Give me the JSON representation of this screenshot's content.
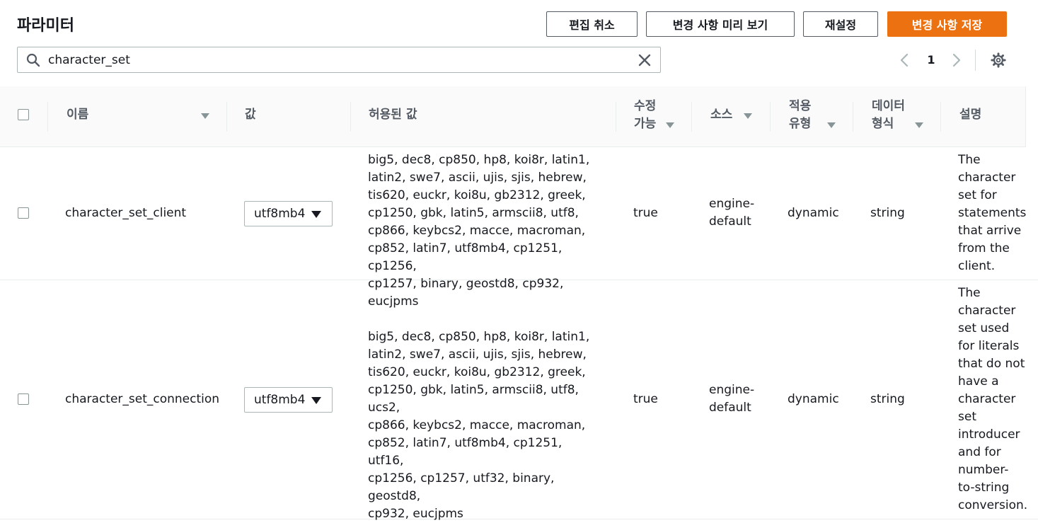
{
  "header": {
    "title": "파라미터",
    "buttons": {
      "cancel_edit": "편집 취소",
      "preview": "변경 사항 미리 보기",
      "reset": "재설정",
      "save": "변경 사항 저장"
    }
  },
  "search": {
    "value": "character_set"
  },
  "pagination": {
    "page": "1"
  },
  "colors": {
    "primary": "#ec7211",
    "border": "#aab7b8",
    "header_text": "#545b64"
  },
  "table": {
    "columns": {
      "name": "이름",
      "value": "값",
      "allowed": "허용된 값",
      "modifiable": [
        "수정",
        "가능"
      ],
      "source": "소스",
      "apply_type": [
        "적용",
        "유형"
      ],
      "data_type": [
        "데이터",
        "형식"
      ],
      "description": "설명"
    },
    "rows": [
      {
        "name": "character_set_client",
        "value": "utf8mb4",
        "allowed": [
          "big5, dec8, cp850, hp8, koi8r, latin1,",
          "latin2, swe7, ascii, ujis, sjis, hebrew,",
          "tis620, euckr, koi8u, gb2312, greek,",
          "cp1250, gbk, latin5, armscii8, utf8,",
          "cp866, keybcs2, macce, macroman,",
          "cp852, latin7, utf8mb4, cp1251, cp1256,",
          "cp1257, binary, geostd8, cp932, eucjpms"
        ],
        "modifiable": "true",
        "source": [
          "engine-",
          "default"
        ],
        "apply_type": "dynamic",
        "data_type": "string",
        "description": [
          "The",
          "character",
          "set for",
          "statements",
          "that arrive",
          "from the",
          "client."
        ]
      },
      {
        "name": "character_set_connection",
        "value": "utf8mb4",
        "allowed": [
          "big5, dec8, cp850, hp8, koi8r, latin1,",
          "latin2, swe7, ascii, ujis, sjis, hebrew,",
          "tis620, euckr, koi8u, gb2312, greek,",
          "cp1250, gbk, latin5, armscii8, utf8, ucs2,",
          "cp866, keybcs2, macce, macroman,",
          "cp852, latin7, utf8mb4, cp1251, utf16,",
          "cp1256, cp1257, utf32, binary, geostd8,",
          "cp932, eucjpms"
        ],
        "modifiable": "true",
        "source": [
          "engine-",
          "default"
        ],
        "apply_type": "dynamic",
        "data_type": "string",
        "description": [
          "The",
          "character",
          "set used",
          "for literals",
          "that do not",
          "have a",
          "character",
          "set",
          "introducer",
          "and for",
          "number-",
          "to-string",
          "conversion."
        ]
      }
    ]
  }
}
